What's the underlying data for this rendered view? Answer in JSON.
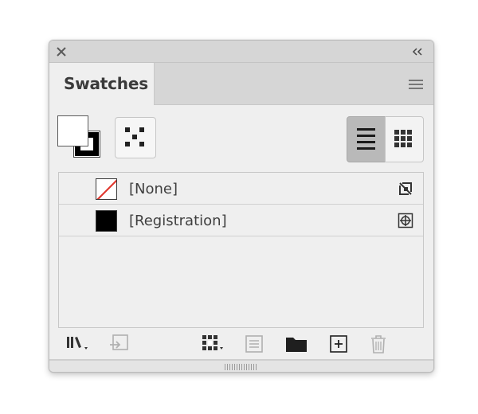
{
  "panel": {
    "tab_label": "Swatches",
    "buttons": {
      "close": "close-icon",
      "collapse": "double-chevron-left-icon",
      "menu": "hamburger-menu-icon"
    }
  },
  "toolbar": {
    "fill_stroke": "fill-stroke-proxy",
    "color_picker": "swatch-options-icon",
    "view_modes": [
      "list-view",
      "grid-view"
    ],
    "selected_view": "list-view"
  },
  "swatches": [
    {
      "label": "[None]",
      "chip": "none",
      "icon": "no-edit-icon"
    },
    {
      "label": "[Registration]",
      "chip": "#000000",
      "icon": "registration-icon"
    }
  ],
  "bottom_toolbar": [
    "swatch-libraries-menu-icon",
    "place-swatches-icon",
    "show-swatch-kinds-menu-icon",
    "swatch-options-icon",
    "new-color-group-icon",
    "new-swatch-icon",
    "delete-swatch-icon"
  ],
  "colors": {
    "accent_none": "#e0362d",
    "panel_bg": "#efefef",
    "header_bg": "#d6d6d6"
  }
}
